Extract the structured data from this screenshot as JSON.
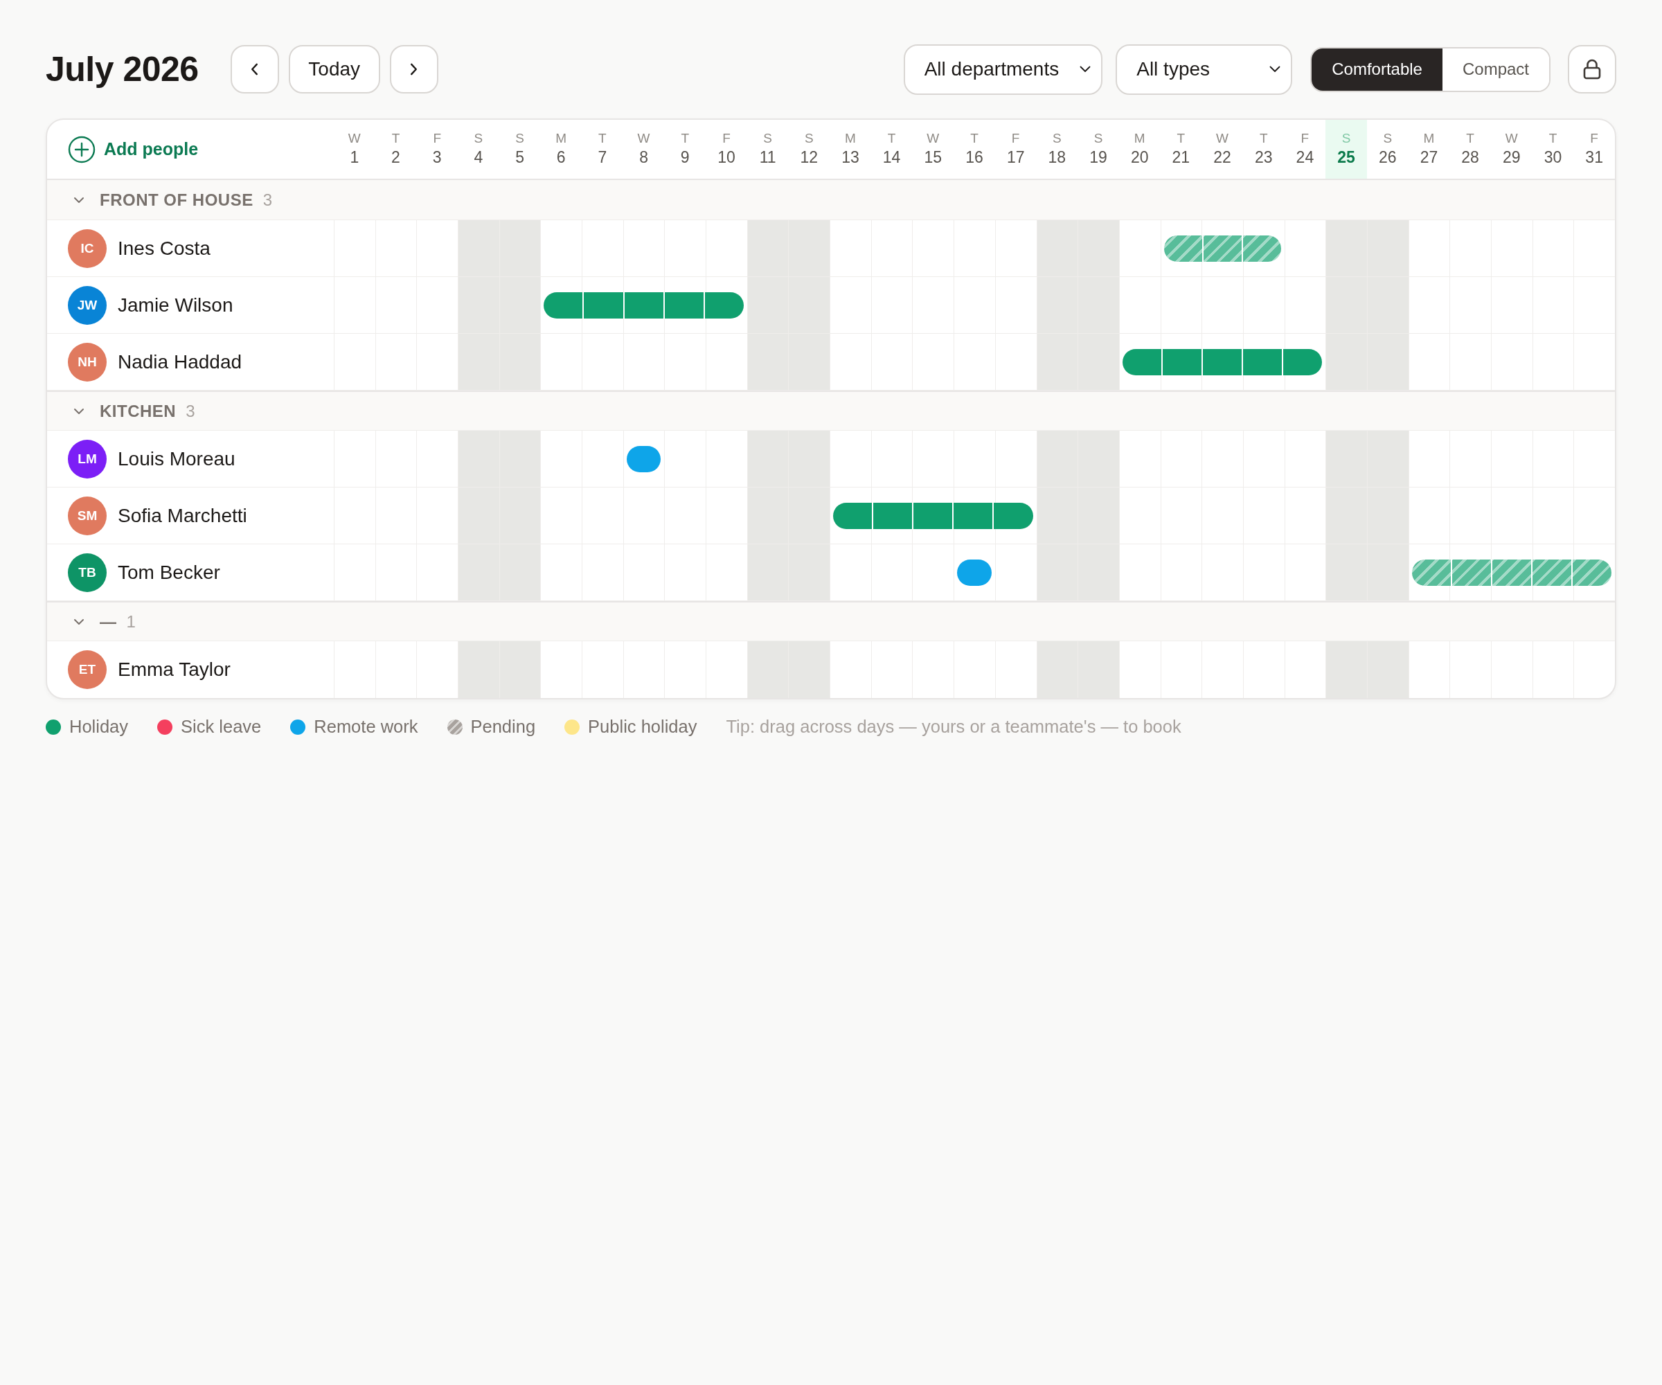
{
  "toolbar": {
    "title": "July 2026",
    "today": "Today",
    "filters": [
      {
        "value": "All departments"
      },
      {
        "value": "All types"
      }
    ],
    "density": [
      {
        "label": "Comfortable",
        "selected": true
      },
      {
        "label": "Compact",
        "selected": false
      }
    ]
  },
  "calendar": {
    "add_people": "Add people",
    "days": [
      {
        "weekday": "W",
        "day": "1",
        "weekend": false,
        "today": false
      },
      {
        "weekday": "T",
        "day": "2",
        "weekend": false,
        "today": false
      },
      {
        "weekday": "F",
        "day": "3",
        "weekend": false,
        "today": false
      },
      {
        "weekday": "S",
        "day": "4",
        "weekend": true,
        "today": false
      },
      {
        "weekday": "S",
        "day": "5",
        "weekend": true,
        "today": false
      },
      {
        "weekday": "M",
        "day": "6",
        "weekend": false,
        "today": false
      },
      {
        "weekday": "T",
        "day": "7",
        "weekend": false,
        "today": false
      },
      {
        "weekday": "W",
        "day": "8",
        "weekend": false,
        "today": false
      },
      {
        "weekday": "T",
        "day": "9",
        "weekend": false,
        "today": false
      },
      {
        "weekday": "F",
        "day": "10",
        "weekend": false,
        "today": false
      },
      {
        "weekday": "S",
        "day": "11",
        "weekend": true,
        "today": false
      },
      {
        "weekday": "S",
        "day": "12",
        "weekend": true,
        "today": false
      },
      {
        "weekday": "M",
        "day": "13",
        "weekend": false,
        "today": false
      },
      {
        "weekday": "T",
        "day": "14",
        "weekend": false,
        "today": false
      },
      {
        "weekday": "W",
        "day": "15",
        "weekend": false,
        "today": false
      },
      {
        "weekday": "T",
        "day": "16",
        "weekend": false,
        "today": false
      },
      {
        "weekday": "F",
        "day": "17",
        "weekend": false,
        "today": false
      },
      {
        "weekday": "S",
        "day": "18",
        "weekend": true,
        "today": false
      },
      {
        "weekday": "S",
        "day": "19",
        "weekend": true,
        "today": false
      },
      {
        "weekday": "M",
        "day": "20",
        "weekend": false,
        "today": false
      },
      {
        "weekday": "T",
        "day": "21",
        "weekend": false,
        "today": false
      },
      {
        "weekday": "W",
        "day": "22",
        "weekend": false,
        "today": false
      },
      {
        "weekday": "T",
        "day": "23",
        "weekend": false,
        "today": false
      },
      {
        "weekday": "F",
        "day": "24",
        "weekend": false,
        "today": false
      },
      {
        "weekday": "S",
        "day": "25",
        "weekend": true,
        "today": true
      },
      {
        "weekday": "S",
        "day": "26",
        "weekend": true,
        "today": false
      },
      {
        "weekday": "M",
        "day": "27",
        "weekend": false,
        "today": false
      },
      {
        "weekday": "T",
        "day": "28",
        "weekend": false,
        "today": false
      },
      {
        "weekday": "W",
        "day": "29",
        "weekend": false,
        "today": false
      },
      {
        "weekday": "T",
        "day": "30",
        "weekend": false,
        "today": false
      },
      {
        "weekday": "F",
        "day": "31",
        "weekend": false,
        "today": false
      }
    ],
    "groups": [
      {
        "name": "FRONT OF HOUSE",
        "count": "3",
        "expanded": true,
        "people": [
          {
            "initials": "IC",
            "name": "Ines Costa",
            "color": "#e07a5f",
            "cells": [
              {
                "kind": "none"
              },
              {
                "kind": "none"
              },
              {
                "kind": "none"
              },
              {
                "kind": "none"
              },
              {
                "kind": "none"
              },
              {
                "kind": "none"
              },
              {
                "kind": "none"
              },
              {
                "kind": "none"
              },
              {
                "kind": "none"
              },
              {
                "kind": "none"
              },
              {
                "kind": "none"
              },
              {
                "kind": "none"
              },
              {
                "kind": "none"
              },
              {
                "kind": "none"
              },
              {
                "kind": "none"
              },
              {
                "kind": "none"
              },
              {
                "kind": "none"
              },
              {
                "kind": "none"
              },
              {
                "kind": "none"
              },
              {
                "kind": "none"
              },
              {
                "kind": "pending"
              },
              {
                "kind": "pending"
              },
              {
                "kind": "pending"
              },
              {
                "kind": "none"
              },
              {
                "kind": "none"
              },
              {
                "kind": "none"
              },
              {
                "kind": "none"
              },
              {
                "kind": "none"
              },
              {
                "kind": "none"
              },
              {
                "kind": "none"
              },
              {
                "kind": "none"
              }
            ]
          },
          {
            "initials": "JW",
            "name": "Jamie Wilson",
            "color": "#0984d6",
            "cells": [
              {
                "kind": "none"
              },
              {
                "kind": "none"
              },
              {
                "kind": "none"
              },
              {
                "kind": "none"
              },
              {
                "kind": "none"
              },
              {
                "kind": "holiday"
              },
              {
                "kind": "holiday"
              },
              {
                "kind": "holiday"
              },
              {
                "kind": "holiday"
              },
              {
                "kind": "holiday"
              },
              {
                "kind": "none"
              },
              {
                "kind": "none"
              },
              {
                "kind": "none"
              },
              {
                "kind": "none"
              },
              {
                "kind": "none"
              },
              {
                "kind": "none"
              },
              {
                "kind": "none"
              },
              {
                "kind": "none"
              },
              {
                "kind": "none"
              },
              {
                "kind": "none"
              },
              {
                "kind": "none"
              },
              {
                "kind": "none"
              },
              {
                "kind": "none"
              },
              {
                "kind": "none"
              },
              {
                "kind": "none"
              },
              {
                "kind": "none"
              },
              {
                "kind": "none"
              },
              {
                "kind": "none"
              },
              {
                "kind": "none"
              },
              {
                "kind": "none"
              },
              {
                "kind": "none"
              }
            ]
          },
          {
            "initials": "NH",
            "name": "Nadia Haddad",
            "color": "#e07a5f",
            "cells": [
              {
                "kind": "none"
              },
              {
                "kind": "none"
              },
              {
                "kind": "none"
              },
              {
                "kind": "none"
              },
              {
                "kind": "none"
              },
              {
                "kind": "none"
              },
              {
                "kind": "none"
              },
              {
                "kind": "none"
              },
              {
                "kind": "none"
              },
              {
                "kind": "none"
              },
              {
                "kind": "none"
              },
              {
                "kind": "none"
              },
              {
                "kind": "none"
              },
              {
                "kind": "none"
              },
              {
                "kind": "none"
              },
              {
                "kind": "none"
              },
              {
                "kind": "none"
              },
              {
                "kind": "none"
              },
              {
                "kind": "none"
              },
              {
                "kind": "holiday"
              },
              {
                "kind": "holiday"
              },
              {
                "kind": "holiday"
              },
              {
                "kind": "holiday"
              },
              {
                "kind": "holiday"
              },
              {
                "kind": "none"
              },
              {
                "kind": "none"
              },
              {
                "kind": "none"
              },
              {
                "kind": "none"
              },
              {
                "kind": "none"
              },
              {
                "kind": "none"
              },
              {
                "kind": "none"
              }
            ]
          }
        ]
      },
      {
        "name": "KITCHEN",
        "count": "3",
        "expanded": true,
        "people": [
          {
            "initials": "LM",
            "name": "Louis Moreau",
            "color": "#7c1ff6",
            "cells": [
              {
                "kind": "none"
              },
              {
                "kind": "none"
              },
              {
                "kind": "none"
              },
              {
                "kind": "none"
              },
              {
                "kind": "none"
              },
              {
                "kind": "none"
              },
              {
                "kind": "none"
              },
              {
                "kind": "remote"
              },
              {
                "kind": "none"
              },
              {
                "kind": "none"
              },
              {
                "kind": "none"
              },
              {
                "kind": "none"
              },
              {
                "kind": "none"
              },
              {
                "kind": "none"
              },
              {
                "kind": "none"
              },
              {
                "kind": "none"
              },
              {
                "kind": "none"
              },
              {
                "kind": "none"
              },
              {
                "kind": "none"
              },
              {
                "kind": "none"
              },
              {
                "kind": "none"
              },
              {
                "kind": "none"
              },
              {
                "kind": "none"
              },
              {
                "kind": "none"
              },
              {
                "kind": "none"
              },
              {
                "kind": "none"
              },
              {
                "kind": "none"
              },
              {
                "kind": "none"
              },
              {
                "kind": "none"
              },
              {
                "kind": "none"
              },
              {
                "kind": "none"
              }
            ]
          },
          {
            "initials": "SM",
            "name": "Sofia Marchetti",
            "color": "#e07a5f",
            "cells": [
              {
                "kind": "none"
              },
              {
                "kind": "none"
              },
              {
                "kind": "none"
              },
              {
                "kind": "none"
              },
              {
                "kind": "none"
              },
              {
                "kind": "none"
              },
              {
                "kind": "none"
              },
              {
                "kind": "none"
              },
              {
                "kind": "none"
              },
              {
                "kind": "none"
              },
              {
                "kind": "none"
              },
              {
                "kind": "none"
              },
              {
                "kind": "holiday"
              },
              {
                "kind": "holiday"
              },
              {
                "kind": "holiday"
              },
              {
                "kind": "holiday"
              },
              {
                "kind": "holiday"
              },
              {
                "kind": "none"
              },
              {
                "kind": "none"
              },
              {
                "kind": "none"
              },
              {
                "kind": "none"
              },
              {
                "kind": "none"
              },
              {
                "kind": "none"
              },
              {
                "kind": "none"
              },
              {
                "kind": "none"
              },
              {
                "kind": "none"
              },
              {
                "kind": "none"
              },
              {
                "kind": "none"
              },
              {
                "kind": "none"
              },
              {
                "kind": "none"
              },
              {
                "kind": "none"
              }
            ]
          },
          {
            "initials": "TB",
            "name": "Tom Becker",
            "color": "#0e9466",
            "cells": [
              {
                "kind": "none"
              },
              {
                "kind": "none"
              },
              {
                "kind": "none"
              },
              {
                "kind": "none"
              },
              {
                "kind": "none"
              },
              {
                "kind": "none"
              },
              {
                "kind": "none"
              },
              {
                "kind": "none"
              },
              {
                "kind": "none"
              },
              {
                "kind": "none"
              },
              {
                "kind": "none"
              },
              {
                "kind": "none"
              },
              {
                "kind": "none"
              },
              {
                "kind": "none"
              },
              {
                "kind": "none"
              },
              {
                "kind": "remote"
              },
              {
                "kind": "none"
              },
              {
                "kind": "none"
              },
              {
                "kind": "none"
              },
              {
                "kind": "none"
              },
              {
                "kind": "none"
              },
              {
                "kind": "none"
              },
              {
                "kind": "none"
              },
              {
                "kind": "none"
              },
              {
                "kind": "none"
              },
              {
                "kind": "none"
              },
              {
                "kind": "pending"
              },
              {
                "kind": "pending"
              },
              {
                "kind": "pending"
              },
              {
                "kind": "pending"
              },
              {
                "kind": "pending"
              }
            ]
          }
        ]
      },
      {
        "name": "—",
        "count": "1",
        "expanded": true,
        "people": [
          {
            "initials": "ET",
            "name": "Emma Taylor",
            "color": "#e07a5f",
            "cells": [
              {
                "kind": "none"
              },
              {
                "kind": "none"
              },
              {
                "kind": "none"
              },
              {
                "kind": "none"
              },
              {
                "kind": "none"
              },
              {
                "kind": "none"
              },
              {
                "kind": "none"
              },
              {
                "kind": "none"
              },
              {
                "kind": "none"
              },
              {
                "kind": "none"
              },
              {
                "kind": "none"
              },
              {
                "kind": "none"
              },
              {
                "kind": "none"
              },
              {
                "kind": "none"
              },
              {
                "kind": "none"
              },
              {
                "kind": "none"
              },
              {
                "kind": "none"
              },
              {
                "kind": "none"
              },
              {
                "kind": "none"
              },
              {
                "kind": "none"
              },
              {
                "kind": "none"
              },
              {
                "kind": "none"
              },
              {
                "kind": "none"
              },
              {
                "kind": "none"
              },
              {
                "kind": "none"
              },
              {
                "kind": "none"
              },
              {
                "kind": "none"
              },
              {
                "kind": "none"
              },
              {
                "kind": "none"
              },
              {
                "kind": "none"
              },
              {
                "kind": "none"
              }
            ]
          }
        ]
      }
    ]
  },
  "legend": {
    "items": [
      {
        "label": "Holiday",
        "kind": "solid",
        "color": "#10a06e"
      },
      {
        "label": "Sick leave",
        "kind": "solid",
        "color": "#f43f5e"
      },
      {
        "label": "Remote work",
        "kind": "solid",
        "color": "#0ea5e9"
      },
      {
        "label": "Pending",
        "kind": "hatched",
        "color": "#a8a29e"
      },
      {
        "label": "Public holiday",
        "kind": "solid",
        "color": "#fde68a"
      }
    ],
    "tip": "Tip: drag across days — yours or a teammate's — to book"
  }
}
